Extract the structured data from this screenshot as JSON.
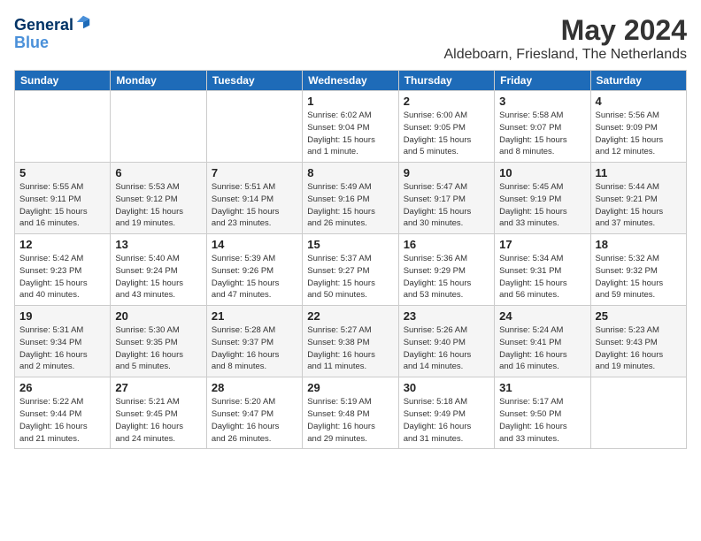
{
  "header": {
    "logo_line1": "General",
    "logo_line2": "Blue",
    "month": "May 2024",
    "location": "Aldeboarn, Friesland, The Netherlands"
  },
  "weekdays": [
    "Sunday",
    "Monday",
    "Tuesday",
    "Wednesday",
    "Thursday",
    "Friday",
    "Saturday"
  ],
  "weeks": [
    [
      {
        "day": "",
        "info": ""
      },
      {
        "day": "",
        "info": ""
      },
      {
        "day": "",
        "info": ""
      },
      {
        "day": "1",
        "info": "Sunrise: 6:02 AM\nSunset: 9:04 PM\nDaylight: 15 hours\nand 1 minute."
      },
      {
        "day": "2",
        "info": "Sunrise: 6:00 AM\nSunset: 9:05 PM\nDaylight: 15 hours\nand 5 minutes."
      },
      {
        "day": "3",
        "info": "Sunrise: 5:58 AM\nSunset: 9:07 PM\nDaylight: 15 hours\nand 8 minutes."
      },
      {
        "day": "4",
        "info": "Sunrise: 5:56 AM\nSunset: 9:09 PM\nDaylight: 15 hours\nand 12 minutes."
      }
    ],
    [
      {
        "day": "5",
        "info": "Sunrise: 5:55 AM\nSunset: 9:11 PM\nDaylight: 15 hours\nand 16 minutes."
      },
      {
        "day": "6",
        "info": "Sunrise: 5:53 AM\nSunset: 9:12 PM\nDaylight: 15 hours\nand 19 minutes."
      },
      {
        "day": "7",
        "info": "Sunrise: 5:51 AM\nSunset: 9:14 PM\nDaylight: 15 hours\nand 23 minutes."
      },
      {
        "day": "8",
        "info": "Sunrise: 5:49 AM\nSunset: 9:16 PM\nDaylight: 15 hours\nand 26 minutes."
      },
      {
        "day": "9",
        "info": "Sunrise: 5:47 AM\nSunset: 9:17 PM\nDaylight: 15 hours\nand 30 minutes."
      },
      {
        "day": "10",
        "info": "Sunrise: 5:45 AM\nSunset: 9:19 PM\nDaylight: 15 hours\nand 33 minutes."
      },
      {
        "day": "11",
        "info": "Sunrise: 5:44 AM\nSunset: 9:21 PM\nDaylight: 15 hours\nand 37 minutes."
      }
    ],
    [
      {
        "day": "12",
        "info": "Sunrise: 5:42 AM\nSunset: 9:23 PM\nDaylight: 15 hours\nand 40 minutes."
      },
      {
        "day": "13",
        "info": "Sunrise: 5:40 AM\nSunset: 9:24 PM\nDaylight: 15 hours\nand 43 minutes."
      },
      {
        "day": "14",
        "info": "Sunrise: 5:39 AM\nSunset: 9:26 PM\nDaylight: 15 hours\nand 47 minutes."
      },
      {
        "day": "15",
        "info": "Sunrise: 5:37 AM\nSunset: 9:27 PM\nDaylight: 15 hours\nand 50 minutes."
      },
      {
        "day": "16",
        "info": "Sunrise: 5:36 AM\nSunset: 9:29 PM\nDaylight: 15 hours\nand 53 minutes."
      },
      {
        "day": "17",
        "info": "Sunrise: 5:34 AM\nSunset: 9:31 PM\nDaylight: 15 hours\nand 56 minutes."
      },
      {
        "day": "18",
        "info": "Sunrise: 5:32 AM\nSunset: 9:32 PM\nDaylight: 15 hours\nand 59 minutes."
      }
    ],
    [
      {
        "day": "19",
        "info": "Sunrise: 5:31 AM\nSunset: 9:34 PM\nDaylight: 16 hours\nand 2 minutes."
      },
      {
        "day": "20",
        "info": "Sunrise: 5:30 AM\nSunset: 9:35 PM\nDaylight: 16 hours\nand 5 minutes."
      },
      {
        "day": "21",
        "info": "Sunrise: 5:28 AM\nSunset: 9:37 PM\nDaylight: 16 hours\nand 8 minutes."
      },
      {
        "day": "22",
        "info": "Sunrise: 5:27 AM\nSunset: 9:38 PM\nDaylight: 16 hours\nand 11 minutes."
      },
      {
        "day": "23",
        "info": "Sunrise: 5:26 AM\nSunset: 9:40 PM\nDaylight: 16 hours\nand 14 minutes."
      },
      {
        "day": "24",
        "info": "Sunrise: 5:24 AM\nSunset: 9:41 PM\nDaylight: 16 hours\nand 16 minutes."
      },
      {
        "day": "25",
        "info": "Sunrise: 5:23 AM\nSunset: 9:43 PM\nDaylight: 16 hours\nand 19 minutes."
      }
    ],
    [
      {
        "day": "26",
        "info": "Sunrise: 5:22 AM\nSunset: 9:44 PM\nDaylight: 16 hours\nand 21 minutes."
      },
      {
        "day": "27",
        "info": "Sunrise: 5:21 AM\nSunset: 9:45 PM\nDaylight: 16 hours\nand 24 minutes."
      },
      {
        "day": "28",
        "info": "Sunrise: 5:20 AM\nSunset: 9:47 PM\nDaylight: 16 hours\nand 26 minutes."
      },
      {
        "day": "29",
        "info": "Sunrise: 5:19 AM\nSunset: 9:48 PM\nDaylight: 16 hours\nand 29 minutes."
      },
      {
        "day": "30",
        "info": "Sunrise: 5:18 AM\nSunset: 9:49 PM\nDaylight: 16 hours\nand 31 minutes."
      },
      {
        "day": "31",
        "info": "Sunrise: 5:17 AM\nSunset: 9:50 PM\nDaylight: 16 hours\nand 33 minutes."
      },
      {
        "day": "",
        "info": ""
      }
    ]
  ]
}
